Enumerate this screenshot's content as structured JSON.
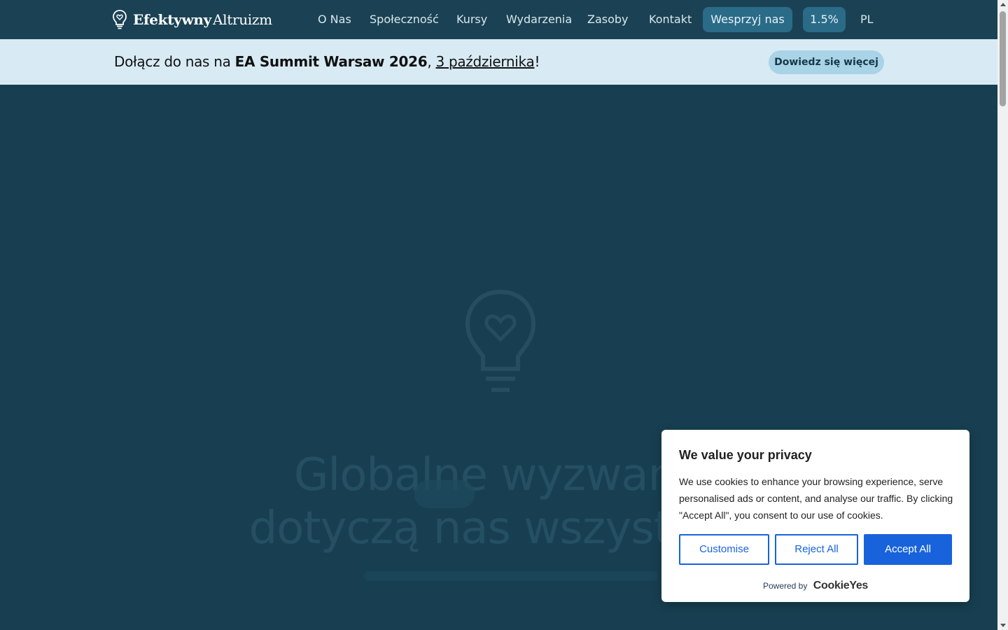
{
  "brand": {
    "name_bold": "Efektywny",
    "name_light": "Altruizm",
    "logo_icon": "lightbulb-heart-icon"
  },
  "nav": {
    "items": [
      "O Nas",
      "Społeczność",
      "Kursy",
      "Wydarzenia",
      "Zasoby",
      "Kontakt"
    ],
    "donate_label": "Wesprzyj nas",
    "percent_label": "1.5%",
    "language": "PL"
  },
  "banner": {
    "text_before": "Dołącz do nas na ",
    "event_name": "EA Summit Warsaw 2026",
    "separator": ", ",
    "date_link": "3 października",
    "text_after": "!",
    "cta_label": "Dowiedz się więcej"
  },
  "hero": {
    "title": "Globalne wyzwania dotyczą nas wszystkich"
  },
  "cookie_banner": {
    "title": "We value your privacy",
    "body": "We use cookies to enhance your browsing experience, serve personalised ads or content, and analyse our traffic. By clicking \"Accept All\", you consent to our use of cookies.",
    "customise_label": "Customise",
    "reject_label": "Reject All",
    "accept_label": "Accept All",
    "powered_by_label": "Powered by",
    "powered_by_brand": "CookieYes"
  },
  "colors": {
    "header_bg": "#1a4254",
    "banner_bg": "#d8ebf4",
    "accent_button": "#2a6b88",
    "cookie_primary": "#1863dc",
    "hero_bg": "#173f51"
  }
}
